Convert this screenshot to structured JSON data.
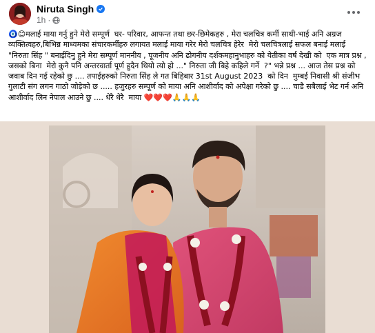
{
  "post": {
    "author": "Niruta Singh",
    "time": "1h",
    "text": "🧿😊मलाई माया गर्नु हुने मेरो सम्पूर्ण  घर- परिवार, आफन्त तथा छर-छिमेकहरु , मेरा चलचित्र कर्मी साथी-भाई अनि अग्रज व्यक्तित्वहरु,बिभिन्न माध्यमका संचारकर्मीहरु लगायत मलाई माया गरेर मेरो चलचित्र हेरेर  मेरो चलचित्रलाई सफल बनाई मलाई \"निरुता सिंह \" बनाईदिनु हुने मेरा सम्पूर्ण माननीय , पूजनीय अनि ढोगनीय दर्शकमहानुभाहरु को येतीका वर्ष देखी को  एक मात्र प्रश्न , जसको बिना  मेरो कुनै पनि अन्तरवार्ता पूर्ण हुदैन थियो त्यो हो ...\" निरुता जी बिहे कहिले गर्ने  ?\" भन्ने प्रश्न ... आज तेस प्रश्न को जवाब दिन गई रहेको छु .... तपाईहरुको निरुता सिंह ले गत बिहिबार 31st August 2023  को दिन  मुम्बई निवासी श्री संजीभ गुलाटी संग लगन गाठो जोड़ेको छ ..... हजुरहरु सम्पूर्ण को माया अनि आशीर्वाद को अपेक्षा गरेको छु .... चाडै सबैलाई भेट गर्न अनि आशीर्वाद लिन नेपाल आउने छु .... धेरै धेरै  माया ❤️❤️❤️🙏🙏🙏"
  },
  "icons": {
    "verified": "verified-badge-icon",
    "privacy": "globe-icon",
    "more": "more-options-icon"
  },
  "colors": {
    "accent": "#1877f2",
    "meta_text": "#65676b",
    "media_background": "#e9ddd3"
  }
}
